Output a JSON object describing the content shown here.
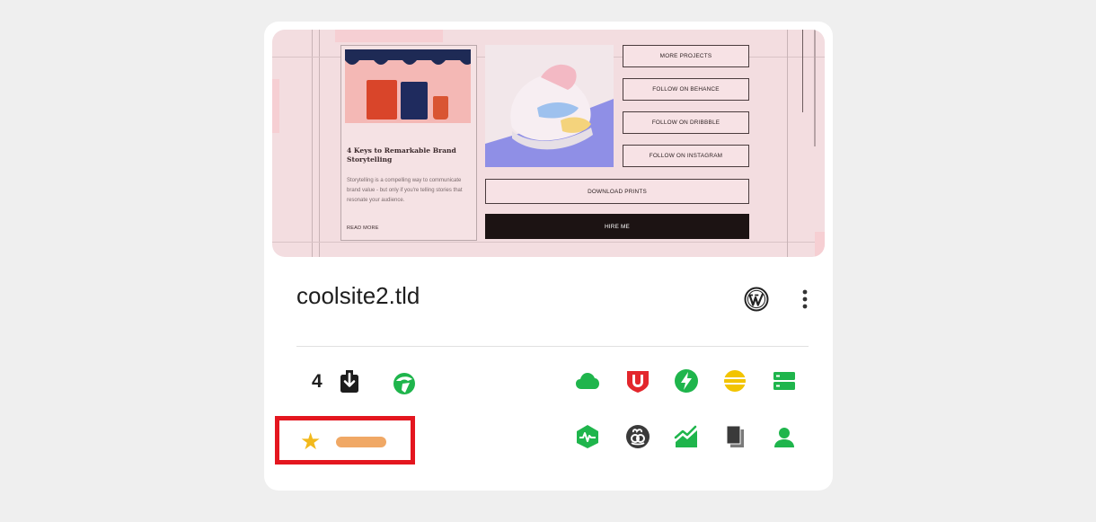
{
  "site": {
    "domain": "coolsite2.tld",
    "platform_icon": "wordpress-icon",
    "menu_icon": "more-vert-icon"
  },
  "preview": {
    "article": {
      "title": "4 Keys to Remarkable Brand Storytelling",
      "body": "Storytelling is a compelling way to communicate brand value - but only if you're telling stories that resonate your audience.",
      "more": "READ MORE"
    },
    "buttons": [
      "MORE PROJECTS",
      "FOLLOW ON BEHANCE",
      "FOLLOW ON DRIBBBLE",
      "FOLLOW ON INSTAGRAM"
    ],
    "download": "DOWNLOAD PRINTS",
    "hire": "HIRE ME"
  },
  "stats": {
    "backups_count": "4",
    "backup_icon": "download-box-icon",
    "update_icon": "green-globe-icon"
  },
  "features_row1": [
    "cloud-icon",
    "shield-badge-icon",
    "bolt-icon",
    "database-icon",
    "server-icon"
  ],
  "features_row2": [
    "hexagon-monitor-icon",
    "link-bubble-icon",
    "trend-chart-icon",
    "documents-icon",
    "user-icon"
  ],
  "rating": {
    "star_icon": "star-icon",
    "value_indicator_color": "#f0a865"
  },
  "colors": {
    "green": "#1fb54c",
    "red": "#e3262c",
    "yellow": "#f2c400",
    "dark": "#3a3a3a",
    "highlight": "#e4161f"
  }
}
